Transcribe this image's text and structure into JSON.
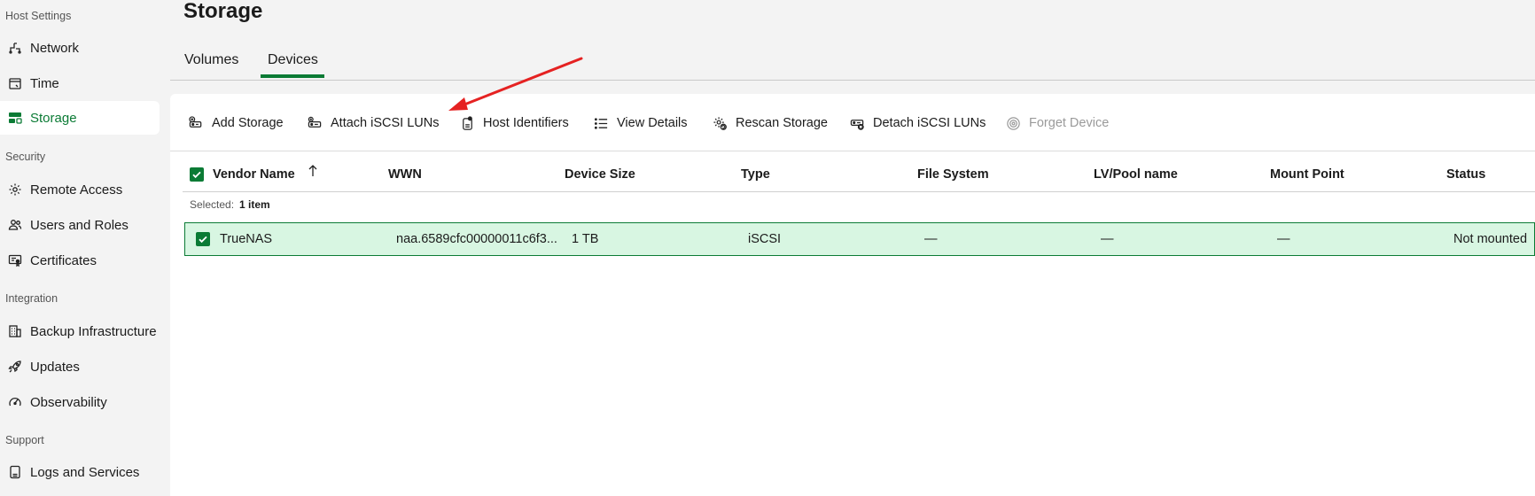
{
  "sidebar": {
    "sections": [
      {
        "label": "Host Settings"
      },
      {
        "label": "Security"
      },
      {
        "label": "Integration"
      },
      {
        "label": "Support"
      }
    ],
    "items": [
      {
        "label": "Network",
        "icon": "network-icon"
      },
      {
        "label": "Time",
        "icon": "calendar-icon"
      },
      {
        "label": "Storage",
        "icon": "storage-icon",
        "active": true
      },
      {
        "label": "Remote Access",
        "icon": "gear-icon"
      },
      {
        "label": "Users and Roles",
        "icon": "users-icon"
      },
      {
        "label": "Certificates",
        "icon": "certificate-icon"
      },
      {
        "label": "Backup Infrastructure",
        "icon": "building-icon"
      },
      {
        "label": "Updates",
        "icon": "rocket-icon"
      },
      {
        "label": "Observability",
        "icon": "gauge-icon"
      },
      {
        "label": "Logs and Services",
        "icon": "document-icon"
      }
    ]
  },
  "page": {
    "title": "Storage",
    "tabs": [
      {
        "label": "Volumes"
      },
      {
        "label": "Devices",
        "active": true
      }
    ]
  },
  "toolbar": {
    "buttons": [
      {
        "label": "Add Storage",
        "icon": "add-storage-icon"
      },
      {
        "label": "Attach iSCSI LUNs",
        "icon": "attach-lun-icon"
      },
      {
        "label": "Host Identifiers",
        "icon": "host-identifier-icon"
      },
      {
        "label": "View Details",
        "icon": "list-icon"
      },
      {
        "label": "Rescan Storage",
        "icon": "rescan-gear-icon"
      },
      {
        "label": "Detach iSCSI LUNs",
        "icon": "detach-lun-icon"
      },
      {
        "label": "Forget Device",
        "icon": "forget-device-icon",
        "disabled": true
      }
    ]
  },
  "table": {
    "columns": [
      "Vendor Name",
      "WWN",
      "Device Size",
      "Type",
      "File System",
      "LV/Pool name",
      "Mount Point",
      "Status"
    ],
    "selected_label": "Selected:",
    "selected_count": "1 item",
    "rows": [
      {
        "vendor": "TrueNAS",
        "wwn": "naa.6589cfc00000011c6f3...",
        "size": "1 TB",
        "type": "iSCSI",
        "fs": "—",
        "pool": "—",
        "mount": "—",
        "status": "Not mounted",
        "selected": true
      }
    ]
  },
  "colors": {
    "accent": "#0b7b35",
    "row_selected_bg": "#d8f6e2",
    "annotation_arrow": "#e52222"
  }
}
